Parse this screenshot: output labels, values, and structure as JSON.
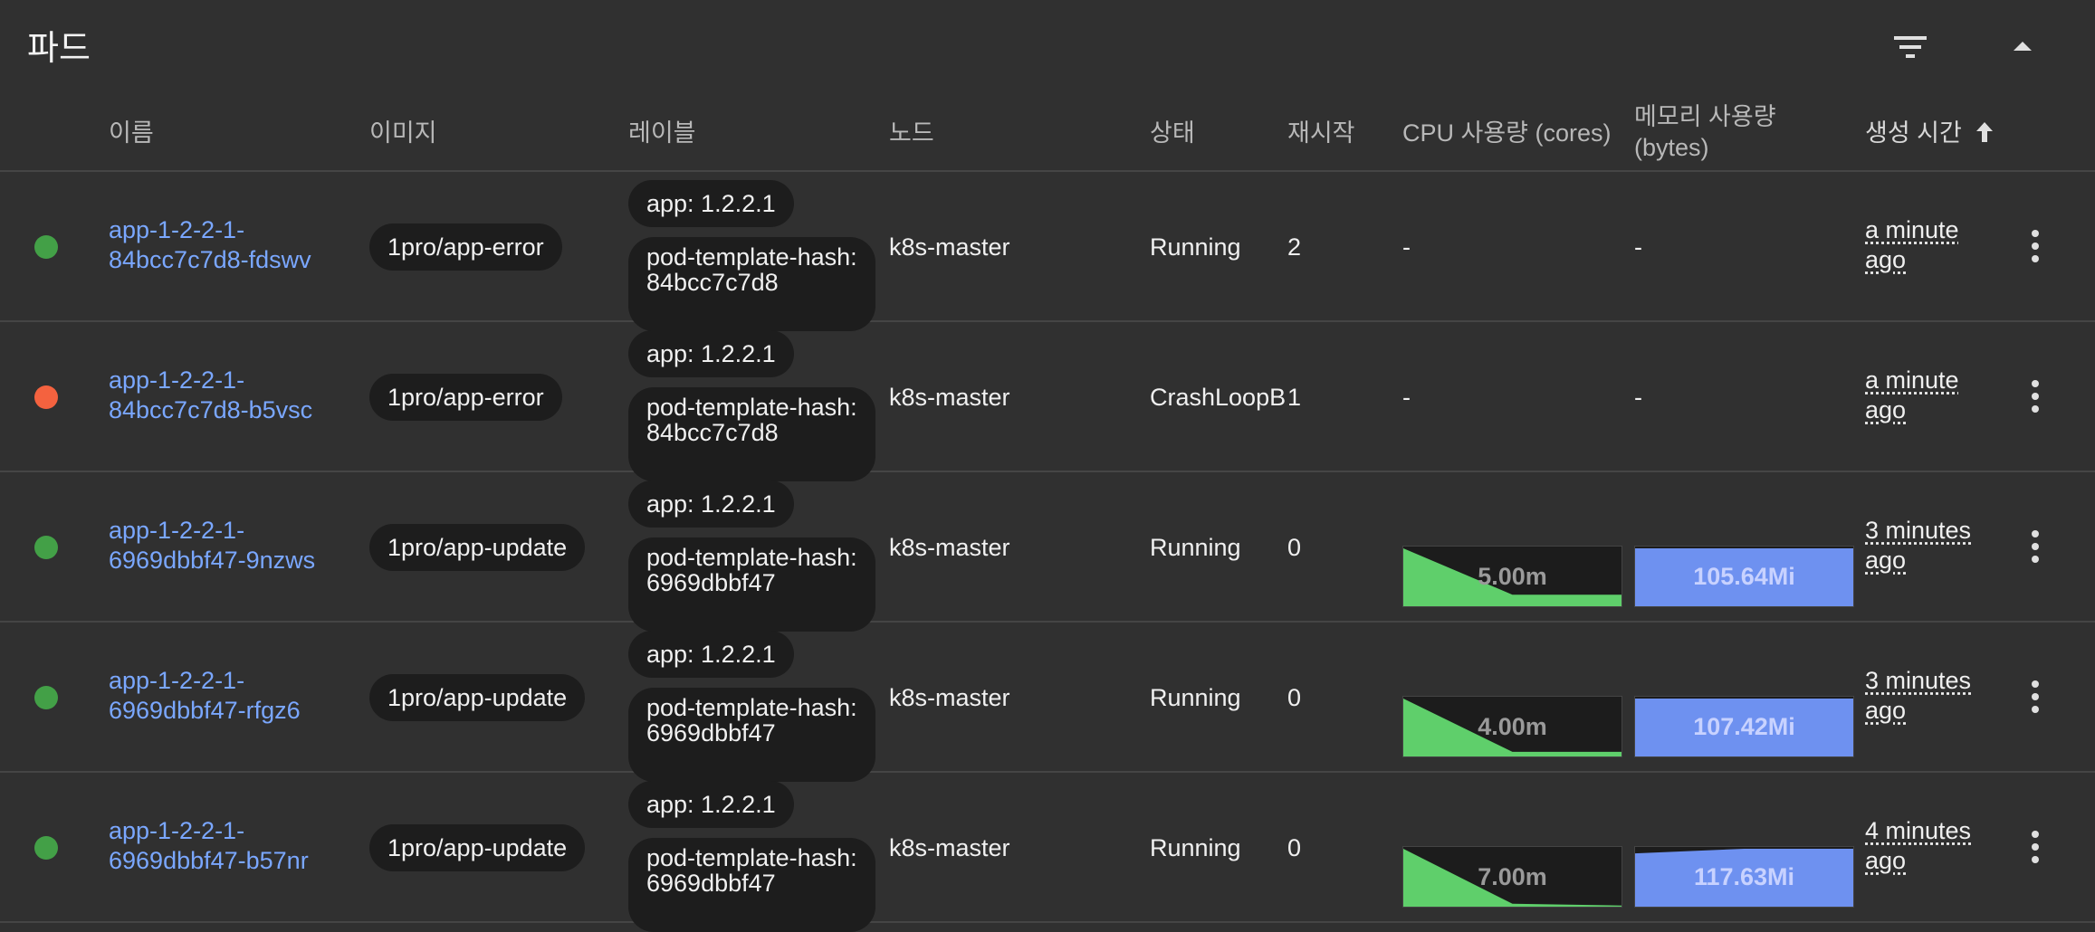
{
  "section": {
    "title": "파드",
    "filter_icon": "filter-icon",
    "collapse_icon": "chevron-up-icon"
  },
  "columns": {
    "name": "이름",
    "image": "이미지",
    "labels": "레이블",
    "node": "노드",
    "status": "상태",
    "restarts": "재시작",
    "cpu": "CPU 사용량 (cores)",
    "memory_line1": "메모리 사용량",
    "memory_line2": "(bytes)",
    "created": "생성 시간",
    "sort_icon": "arrow-up-icon"
  },
  "colors": {
    "running": "#43a047",
    "error": "#f4623f",
    "link": "#7aa7ff",
    "cpu_fill": "#5fcf6b",
    "memory_fill": "#6e91f0"
  },
  "pods": [
    {
      "status_color": "running",
      "name_line1": "app-1-2-2-1-",
      "name_line2": "84bcc7c7d8-fdswv",
      "image": "1pro/app-error",
      "label1": "app: 1.2.2.1",
      "label2": "pod-template-hash: 84bcc7c7d8",
      "node": "k8s-master",
      "status": "Running",
      "restarts": "2",
      "cpu": "-",
      "memory": "-",
      "created_line1": "a minute",
      "created_line2": "ago"
    },
    {
      "status_color": "error",
      "name_line1": "app-1-2-2-1-",
      "name_line2": "84bcc7c7d8-b5vsc",
      "image": "1pro/app-error",
      "label1": "app: 1.2.2.1",
      "label2": "pod-template-hash: 84bcc7c7d8",
      "node": "k8s-master",
      "status": "CrashLoopBackOff",
      "restarts": "1",
      "cpu": "-",
      "memory": "-",
      "created_line1": "a minute",
      "created_line2": "ago"
    },
    {
      "status_color": "running",
      "name_line1": "app-1-2-2-1-",
      "name_line2": "6969dbbf47-9nzws",
      "image": "1pro/app-update",
      "label1": "app: 1.2.2.1",
      "label2": "pod-template-hash: 6969dbbf47",
      "node": "k8s-master",
      "status": "Running",
      "restarts": "0",
      "cpu_label": "5.00m",
      "memory_label": "105.64Mi",
      "cpu_series": [
        1.0,
        0.2,
        0.2
      ],
      "memory_series": [
        1.0,
        1.0,
        1.0
      ],
      "created_line1": "3 minutes",
      "created_line2": "ago"
    },
    {
      "status_color": "running",
      "name_line1": "app-1-2-2-1-",
      "name_line2": "6969dbbf47-rfgz6",
      "image": "1pro/app-update",
      "label1": "app: 1.2.2.1",
      "label2": "pod-template-hash: 6969dbbf47",
      "node": "k8s-master",
      "status": "Running",
      "restarts": "0",
      "cpu_label": "4.00m",
      "memory_label": "107.42Mi",
      "cpu_series": [
        1.0,
        0.08,
        0.08
      ],
      "memory_series": [
        1.0,
        1.0,
        1.0
      ],
      "created_line1": "3 minutes",
      "created_line2": "ago"
    },
    {
      "status_color": "running",
      "name_line1": "app-1-2-2-1-",
      "name_line2": "6969dbbf47-b57nr",
      "image": "1pro/app-update",
      "label1": "app: 1.2.2.1",
      "label2": "pod-template-hash: 6969dbbf47",
      "node": "k8s-master",
      "status": "Running",
      "restarts": "0",
      "cpu_label": "7.00m",
      "memory_label": "117.63Mi",
      "cpu_series": [
        1.0,
        0.05,
        0.02
      ],
      "memory_series": [
        0.92,
        1.0,
        1.0
      ],
      "created_line1": "4 minutes",
      "created_line2": "ago"
    }
  ]
}
